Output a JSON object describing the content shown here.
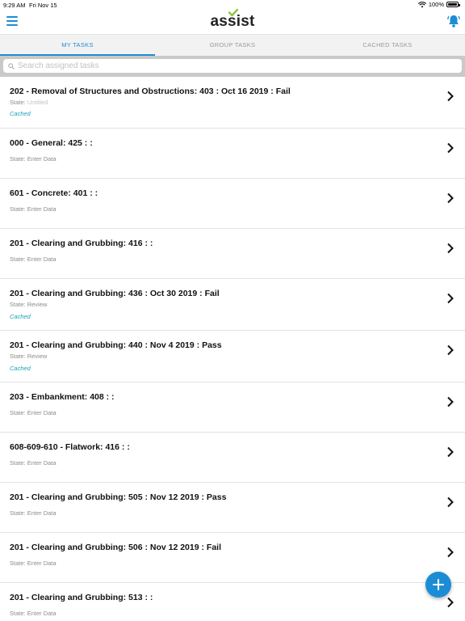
{
  "status_bar": {
    "time": "9:29 AM",
    "date": "Fri Nov 15",
    "battery": "100%"
  },
  "header": {
    "logo": "assist",
    "menu_icon": "hamburger-menu-icon",
    "bell_icon": "bell-alert-icon"
  },
  "colors": {
    "accent": "#1c8dd4",
    "cached": "#14a3b8",
    "logo_check": "#8dc63f"
  },
  "tabs": [
    {
      "label": "MY TASKS",
      "active": true
    },
    {
      "label": "GROUP TASKS",
      "active": false
    },
    {
      "label": "CACHED TASKS",
      "active": false
    }
  ],
  "search": {
    "placeholder": "Search assigned tasks",
    "value": ""
  },
  "tasks": [
    {
      "title": "202 - Removal of Structures and Obstructions: 403 : Oct 16 2019 : Fail",
      "state_label": "State:",
      "state_value": "Untitled",
      "cached": "Cached"
    },
    {
      "title": "000 - General: 425 :  :",
      "state_label": "State:",
      "state_value": "Enter Data",
      "cached": ""
    },
    {
      "title": "601 - Concrete: 401 :  :",
      "state_label": "State:",
      "state_value": "Enter Data",
      "cached": ""
    },
    {
      "title": "201 - Clearing and Grubbing: 416 :  :",
      "state_label": "State:",
      "state_value": "Enter Data",
      "cached": ""
    },
    {
      "title": "201 - Clearing and Grubbing: 436 : Oct 30 2019 : Fail",
      "state_label": "State:",
      "state_value": "Review",
      "cached": "Cached"
    },
    {
      "title": "201 - Clearing and Grubbing: 440 : Nov 4 2019 : Pass",
      "state_label": "State:",
      "state_value": "Review",
      "cached": "Cached"
    },
    {
      "title": "203 - Embankment: 408 :  :",
      "state_label": "State:",
      "state_value": "Enter Data",
      "cached": ""
    },
    {
      "title": "608-609-610 - Flatwork: 416 :  :",
      "state_label": "State:",
      "state_value": "Enter Data",
      "cached": ""
    },
    {
      "title": "201 - Clearing and Grubbing: 505 : Nov 12 2019 : Pass",
      "state_label": "State:",
      "state_value": "Enter Data",
      "cached": ""
    },
    {
      "title": "201 - Clearing and Grubbing: 506 : Nov 12 2019 : Fail",
      "state_label": "State:",
      "state_value": "Enter Data",
      "cached": ""
    },
    {
      "title": "201 - Clearing and Grubbing: 513 :  :",
      "state_label": "State:",
      "state_value": "Enter Data",
      "cached": ""
    }
  ],
  "fab": {
    "icon": "plus-icon"
  }
}
